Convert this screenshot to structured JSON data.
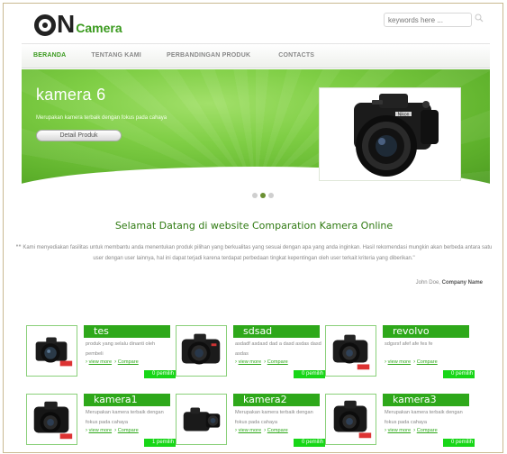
{
  "brand": {
    "logo_n": "N",
    "logo_camera": "Camera"
  },
  "search": {
    "placeholder": "keywords here ..."
  },
  "nav": {
    "items": [
      "BERANDA",
      "TENTANG KAMI",
      "PERBANDINGAN PRODUK",
      "CONTACTS"
    ],
    "active": "BERANDA"
  },
  "slider": {
    "title": "kamera 6",
    "description": "Merupakan kamera terbaik dengan fokus pada cahaya",
    "button_label": "Detail Produk",
    "photo_brand": "Nikon",
    "dots_total": 3,
    "dots_active_index": 1
  },
  "welcome": {
    "title": "Selamat Datang di website Comparation Kamera Online",
    "quote_mark": "““",
    "text": "Kami menyediakan fasilitas untuk membantu anda menentukan produk pilihan yang berkualitas yang sesuai dengan apa yang anda inginkan. Hasil rekomendasi mungkin akan berbeda antara satu user dengan user lainnya, hal ini dapat terjadi karena terdapat perbedaan tingkat kepentingan oleh user terkait kriteria yang diberikan.\"",
    "author_name": "John Doe,",
    "author_company": "Company Name"
  },
  "products": [
    {
      "title": "tes",
      "desc": "produk yang selalu dinanti oleh pembeli",
      "view_label": "view more",
      "compare_label": "Compare",
      "pemilih": "0 pemilih",
      "icon": "camera-icon"
    },
    {
      "title": "sdsad",
      "desc": "asdadf asdasd dad a dasd asdas dasd asdas",
      "view_label": "view more",
      "compare_label": "Compare",
      "pemilih": "0 pemilih",
      "icon": "camera-icon"
    },
    {
      "title": "revolvo",
      "desc": "sdgsrsf afef afe fes fe",
      "view_label": "view more",
      "compare_label": "Compare",
      "pemilih": "0 pemilih",
      "icon": "camera-icon"
    },
    {
      "title": "kamera1",
      "desc": "Merupakan kamera terbaik dengan fokus pada cahaya",
      "view_label": "view more",
      "compare_label": "Compare",
      "pemilih": "1 pemilih",
      "icon": "camera-icon"
    },
    {
      "title": "kamera2",
      "desc": "Merupakan kamera terbaik dengan fokus pada cahaya",
      "view_label": "view more",
      "compare_label": "Compare",
      "pemilih": "0 pemilih",
      "icon": "camera-icon"
    },
    {
      "title": "kamera3",
      "desc": "Merupakan kamera terbaik dengan fokus pada cahaya",
      "view_label": "view more",
      "compare_label": "Compare",
      "pemilih": "0 pemilih",
      "icon": "camera-icon"
    }
  ],
  "colors": {
    "brand_green": "#2ea81a",
    "badge_green": "#17d617",
    "slider_green": "#6cc03a"
  }
}
